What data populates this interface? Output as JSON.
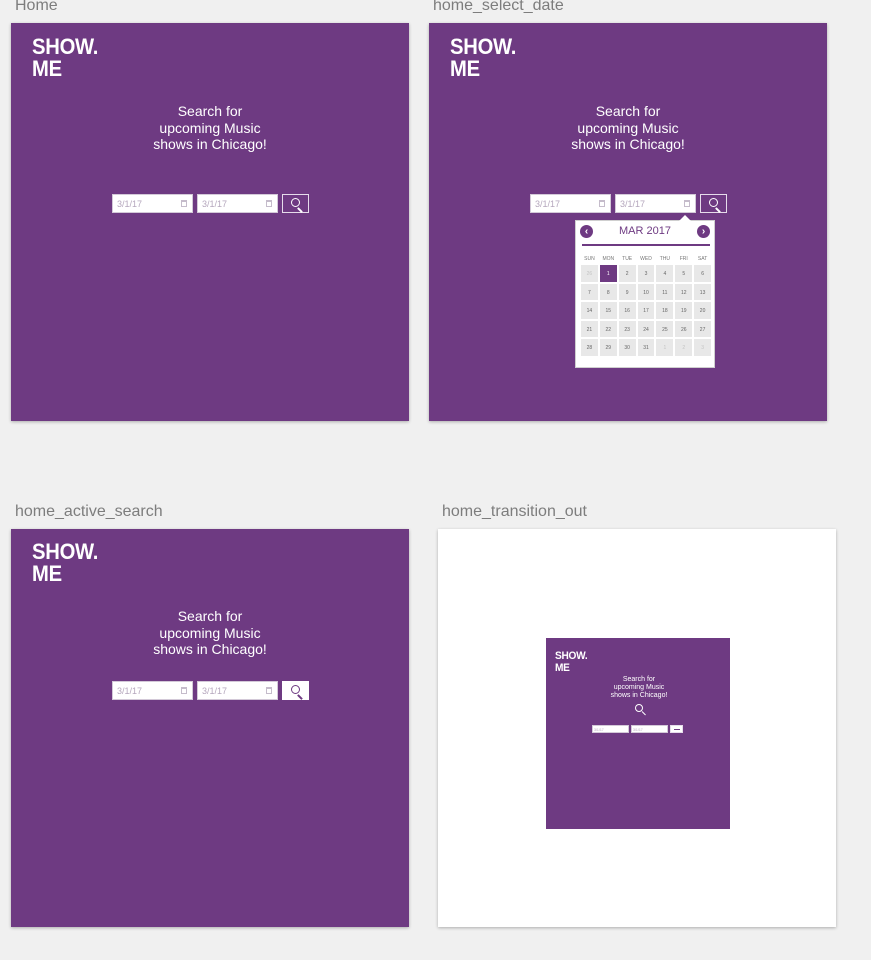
{
  "brand": {
    "logo_line1": "SHOW.",
    "logo_line2": "ME",
    "tagline_1": "Search for",
    "tagline_2": "upcoming Music",
    "tagline_3": "shows in Chicago!"
  },
  "artboards": [
    {
      "name": "Home",
      "start_date": "3/1/17",
      "end_date": "3/1/17"
    },
    {
      "name": "home_select_date",
      "start_date": "3/1/17",
      "end_date": "3/1/17"
    },
    {
      "name": "home_active_search",
      "start_date": "3/1/17",
      "end_date": "3/1/17"
    },
    {
      "name": "home_transition_out",
      "start_date": "3/1/17",
      "end_date": "3/1/17"
    }
  ],
  "calendar": {
    "title": "MAR 2017",
    "prev_glyph": "‹",
    "next_glyph": "›",
    "weekdays": [
      "SUN",
      "MON",
      "TUE",
      "WED",
      "THU",
      "FRI",
      "SAT"
    ],
    "days": [
      "26",
      "1",
      "2",
      "3",
      "4",
      "5",
      "6",
      "7",
      "8",
      "9",
      "10",
      "11",
      "12",
      "13",
      "14",
      "15",
      "16",
      "17",
      "18",
      "19",
      "20",
      "21",
      "22",
      "23",
      "24",
      "25",
      "26",
      "27",
      "28",
      "29",
      "30",
      "31",
      "1",
      "2",
      "3"
    ],
    "muted_days": [
      0,
      32,
      33,
      34
    ],
    "selected_day": 1
  },
  "colors": {
    "brand_purple": "#6e3a82",
    "canvas": "#f0f0f0"
  },
  "icons": {
    "search": "search-icon",
    "calendar": "calendar-icon",
    "prev": "chevron-left-icon",
    "next": "chevron-right-icon"
  }
}
